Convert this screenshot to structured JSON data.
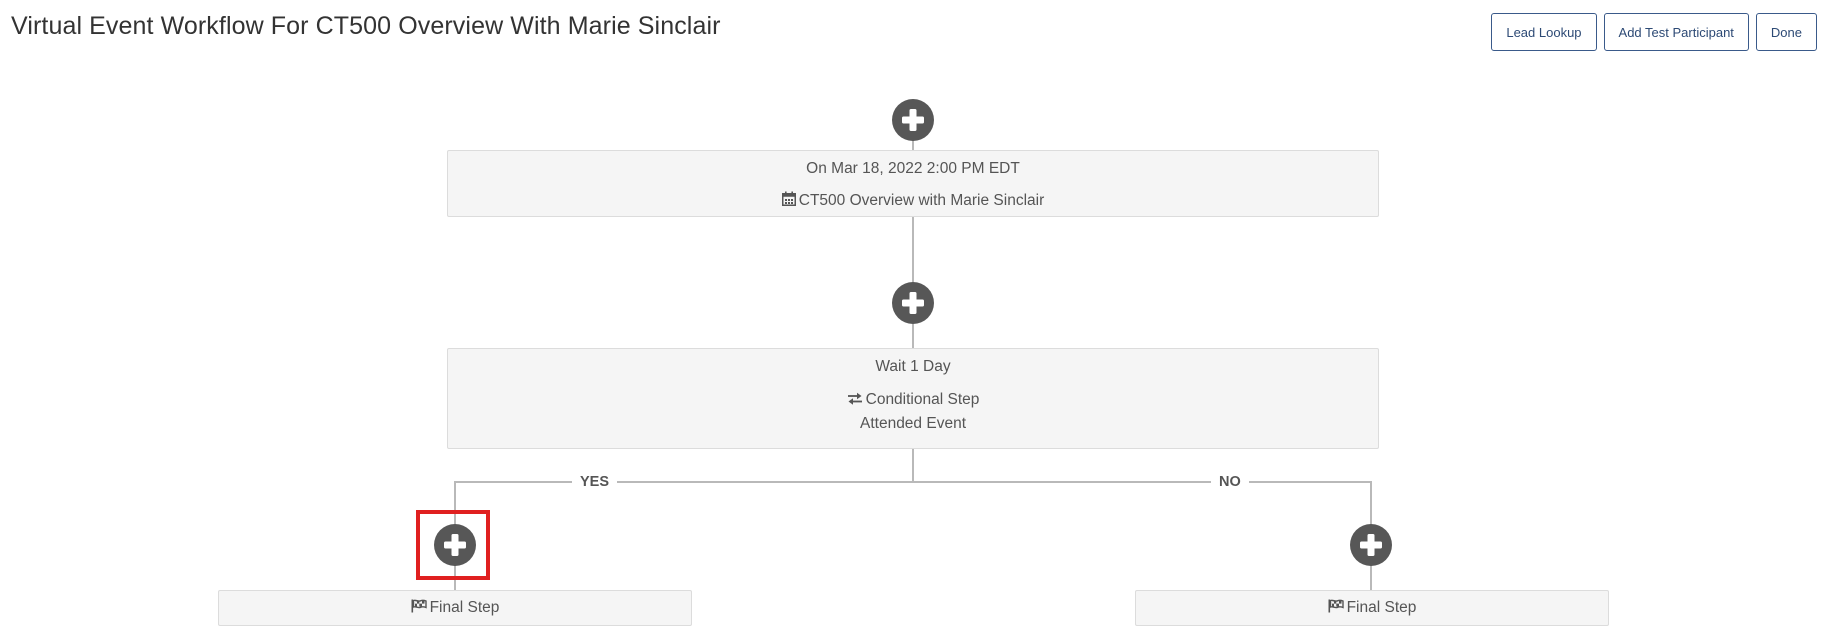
{
  "page": {
    "title": "Virtual Event Workflow For CT500 Overview With Marie Sinclair"
  },
  "toolbar": {
    "lead_lookup_label": "Lead Lookup",
    "add_test_participant_label": "Add Test Participant",
    "done_label": "Done"
  },
  "workflow": {
    "event_card": {
      "date_text": "On Mar 18, 2022 2:00 PM EDT",
      "event_name": "CT500 Overview with Marie Sinclair",
      "icon": "calendar-icon"
    },
    "wait_card": {
      "wait_text": "Wait 1 Day",
      "step_type": "Conditional Step",
      "condition": "Attended Event",
      "icon": "exchange-arrows-icon"
    },
    "branches": {
      "yes_label": "YES",
      "no_label": "NO"
    },
    "final_steps": {
      "yes_label": "Final Step",
      "no_label": "Final Step",
      "icon": "flag-icon"
    },
    "add_step_icon": "plus-circle-icon"
  },
  "colors": {
    "button_border": "#3a5a8a",
    "add_button_fill": "#575757",
    "card_background": "#f5f5f5",
    "connector_line": "#b9b9b9",
    "highlight_box": "#e02020"
  }
}
